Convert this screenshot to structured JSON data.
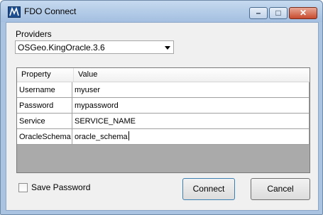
{
  "window": {
    "title": "FDO Connect"
  },
  "titlebar": {
    "min_glyph": "–",
    "max_glyph": "□",
    "close_glyph": "✕"
  },
  "providers": {
    "label": "Providers",
    "selected": "OSGeo.KingOracle.3.6"
  },
  "grid": {
    "headers": {
      "property": "Property",
      "value": "Value"
    },
    "rows": [
      {
        "property": "Username",
        "value": "myuser"
      },
      {
        "property": "Password",
        "value": "mypassword"
      },
      {
        "property": "Service",
        "value": "SERVICE_NAME"
      },
      {
        "property": "OracleSchema",
        "value": "oracle_schema"
      }
    ]
  },
  "save_password": {
    "label": "Save Password",
    "checked": false
  },
  "buttons": {
    "connect": "Connect",
    "cancel": "Cancel"
  }
}
